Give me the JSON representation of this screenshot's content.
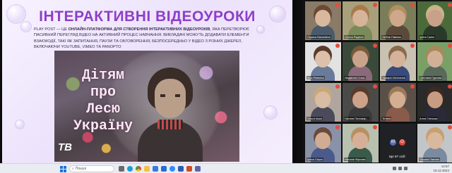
{
  "slide": {
    "title": "ІНТЕРАКТИВНІ ВІДЕОУРОКИ",
    "desc_part1": "Play Post — це ",
    "desc_bold": "онлайн-платформа для створення інтерактивних відеоуроків",
    "desc_part2": ", яка перетворює пасивний перегляд відео на активний процес навчання. Викладачі можуть додавати елементи взаємодії, такі як запитання, паузи та обговорення, безпосередньо у відео з різних джерел, включаючи YouTube, Vimeo та Panopto",
    "video_text_1": "Дітям",
    "video_text_2": "про",
    "video_text_3": "Лесю",
    "video_text_4": "Україну",
    "video_logo": "ТВ"
  },
  "participants": [
    {
      "name": "Лариса Василівна",
      "bg": "#8a7a68",
      "skin": "#d9b8a0",
      "cloth": "#4a5a6a",
      "hair": "#6b4a32"
    },
    {
      "name": "Олена Радюся",
      "bg": "#a8a07a",
      "skin": "#d6b49a",
      "cloth": "#7a8a5a",
      "hair": "#a87a4a"
    },
    {
      "name": "Любов Павлюк",
      "bg": "#7a7d5a",
      "skin": "#cfa88c",
      "cloth": "#5a4a3a",
      "hair": "#b09060"
    },
    {
      "name": "Ірина Гринь",
      "bg": "#4a6a3a",
      "skin": "#c9a08a",
      "cloth": "#2a3a2a",
      "hair": "#c9b48a"
    },
    {
      "name": "Інна Ревієнко",
      "bg": "#e2e2e2",
      "skin": "#dcc0aa",
      "cloth": "#6a7a9a",
      "hair": "#5a3a2a"
    },
    {
      "name": "Людмила Стась",
      "bg": "#3a4a3a",
      "skin": "#caa48a",
      "cloth": "#8a6a7a",
      "hair": "#7a5a3a"
    },
    {
      "name": "Тамара Світлинна",
      "bg": "#c9c2b2",
      "skin": "#d5b39b",
      "cloth": "#3a4a7a",
      "hair": "#8a6a4a"
    },
    {
      "name": "Світлана Гурьєва",
      "bg": "#7aa068",
      "skin": "#d2b097",
      "cloth": "#5a6a5a",
      "hair": "#a88a5a"
    },
    {
      "name": "Ольга Ілько",
      "bg": "#b0a6a0",
      "skin": "#d8bca6",
      "cloth": "#4a4a5a",
      "hair": "#c8a878"
    },
    {
      "name": "Наталя Пономар...",
      "bg": "#4a4a48",
      "skin": "#cda28a",
      "cloth": "#3a3a3a",
      "hair": "#5a3a2a"
    },
    {
      "name": "Тетяна",
      "bg": "#5a5048",
      "skin": "#d4ae92",
      "cloth": "#8a5a4a",
      "hair": "#9a7a5a"
    },
    {
      "name": "Алла Глінська",
      "bg": "#2a2a2a",
      "skin": "#c89c82",
      "cloth": "#2a2a3a",
      "hair": "#3a2a22"
    },
    {
      "name": "Ірина Огірко",
      "bg": "#8a92a8",
      "skin": "#d0ac94",
      "cloth": "#4a5a8a",
      "hair": "#6a4a3a"
    },
    {
      "name": "Наталія Фірсова",
      "bg": "#b8c0b0",
      "skin": "#d6b096",
      "cloth": "#3a5a4a",
      "hair": "#b89060"
    },
    {
      "name": "Ще 97 осіб",
      "special": true
    },
    {
      "name": "Оксана Павлюк",
      "bg": "#c2c6c8",
      "skin": "#d9b99e",
      "cloth": "#7a8aa0",
      "hair": "#c9a070"
    }
  ],
  "taskbar": {
    "search_placeholder": "Пошук",
    "time": "14:57",
    "date": "19.12.2024"
  }
}
